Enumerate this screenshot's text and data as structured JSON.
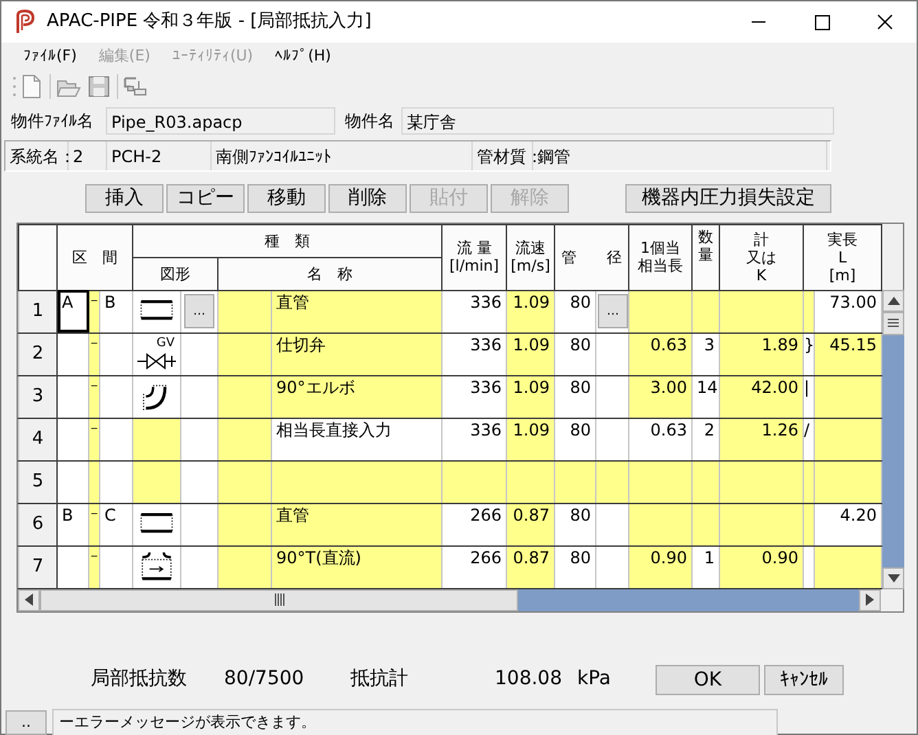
{
  "window": {
    "title": "APAC-PIPE 令和３年版 - [局部抵抗入力]"
  },
  "menu": [
    {
      "label": "ﾌｧｲﾙ(F)",
      "disabled": false
    },
    {
      "label": "編集(E)",
      "disabled": true
    },
    {
      "label": "ﾕｰﾃｨﾘﾃｨ(U)",
      "disabled": true
    },
    {
      "label": "ﾍﾙﾌﾟ(H)",
      "disabled": false
    }
  ],
  "toolbar": [
    {
      "kind": "new"
    },
    {
      "kind": "open"
    },
    {
      "kind": "save"
    },
    {
      "kind": "export"
    }
  ],
  "project": {
    "file_label": "物件ﾌｧｲﾙ名",
    "file_value": "Pipe_R03.apacp",
    "name_label": "物件名",
    "name_value": "某庁舎"
  },
  "system": {
    "label": "系統名：",
    "number": "2",
    "code": "PCH-2",
    "description": "南側ﾌｧﾝｺｲﾙﾕﾆｯﾄ",
    "material_label": "管材質：",
    "material": "鋼管"
  },
  "actions": [
    {
      "label": "挿入",
      "disabled": false
    },
    {
      "label": "コピー",
      "disabled": false
    },
    {
      "label": "移動",
      "disabled": false
    },
    {
      "label": "削除",
      "disabled": false
    },
    {
      "label": "貼付",
      "disabled": true
    },
    {
      "label": "解除",
      "disabled": true
    }
  ],
  "equipment_button": "機器内圧力損失設定",
  "table": {
    "headers": {
      "section": "区　間",
      "type": "種　類",
      "shape": "図形",
      "name": "名　称",
      "flow": [
        "流 量",
        "[l/min]"
      ],
      "velocity": [
        "流速",
        "[m/s]"
      ],
      "diameter": "管　　径",
      "per_unit": [
        "1個当",
        "相当長"
      ],
      "quantity": [
        "数",
        "量"
      ],
      "total": [
        "計",
        "又は",
        "K"
      ],
      "length": [
        "実長",
        "L",
        "[m]"
      ]
    },
    "browse_label": "…",
    "rows": [
      {
        "no": "1",
        "selected": true,
        "kind": "pipe",
        "from": "A",
        "separator": "−",
        "to": "B",
        "name": "直管",
        "flow": "336",
        "velocity": "1.09",
        "diameter": "80",
        "length": "73.00"
      },
      {
        "no": "2",
        "selected": false,
        "kind": "gate_valve",
        "symbol_label": "GV",
        "separator": "−",
        "name": "仕切弁",
        "flow": "336",
        "velocity": "1.09",
        "diameter": "80",
        "per_unit": "0.63",
        "quantity": "3",
        "total": "1.89",
        "bracket": "}",
        "length": "45.15"
      },
      {
        "no": "3",
        "selected": false,
        "kind": "elbow",
        "separator": "−",
        "name": "90°エルボ",
        "flow": "336",
        "velocity": "1.09",
        "diameter": "80",
        "per_unit": "3.00",
        "quantity": "14",
        "total": "42.00",
        "bracket": "|"
      },
      {
        "no": "4",
        "selected": false,
        "kind": "direct",
        "separator": "−",
        "name": "相当長直接入力",
        "flow": "336",
        "velocity": "1.09",
        "diameter": "80",
        "per_unit": "0.63",
        "quantity": "2",
        "total": "1.26",
        "bracket": "/"
      },
      {
        "no": "5",
        "selected": false,
        "kind": "empty"
      },
      {
        "no": "6",
        "selected": false,
        "kind": "pipe",
        "from": "B",
        "separator": "−",
        "to": "C",
        "name": "直管",
        "flow": "266",
        "velocity": "0.87",
        "diameter": "80",
        "length": "4.20"
      },
      {
        "no": "7",
        "selected": false,
        "kind": "tee",
        "separator": "−",
        "name": "90°T(直流)",
        "flow": "266",
        "velocity": "0.87",
        "diameter": "80",
        "per_unit": "0.90",
        "quantity": "1",
        "total": "0.90"
      }
    ]
  },
  "summary": {
    "count_label": "局部抵抗数",
    "count": "80/7500",
    "resistance_label": "抵抗計",
    "resistance": "108.08",
    "unit": "kPa"
  },
  "buttons": [
    "OK",
    "ｷｬﾝｾﾙ"
  ],
  "status": {
    "button": "..",
    "message": "ーエラーメッセージが表示できます。"
  }
}
